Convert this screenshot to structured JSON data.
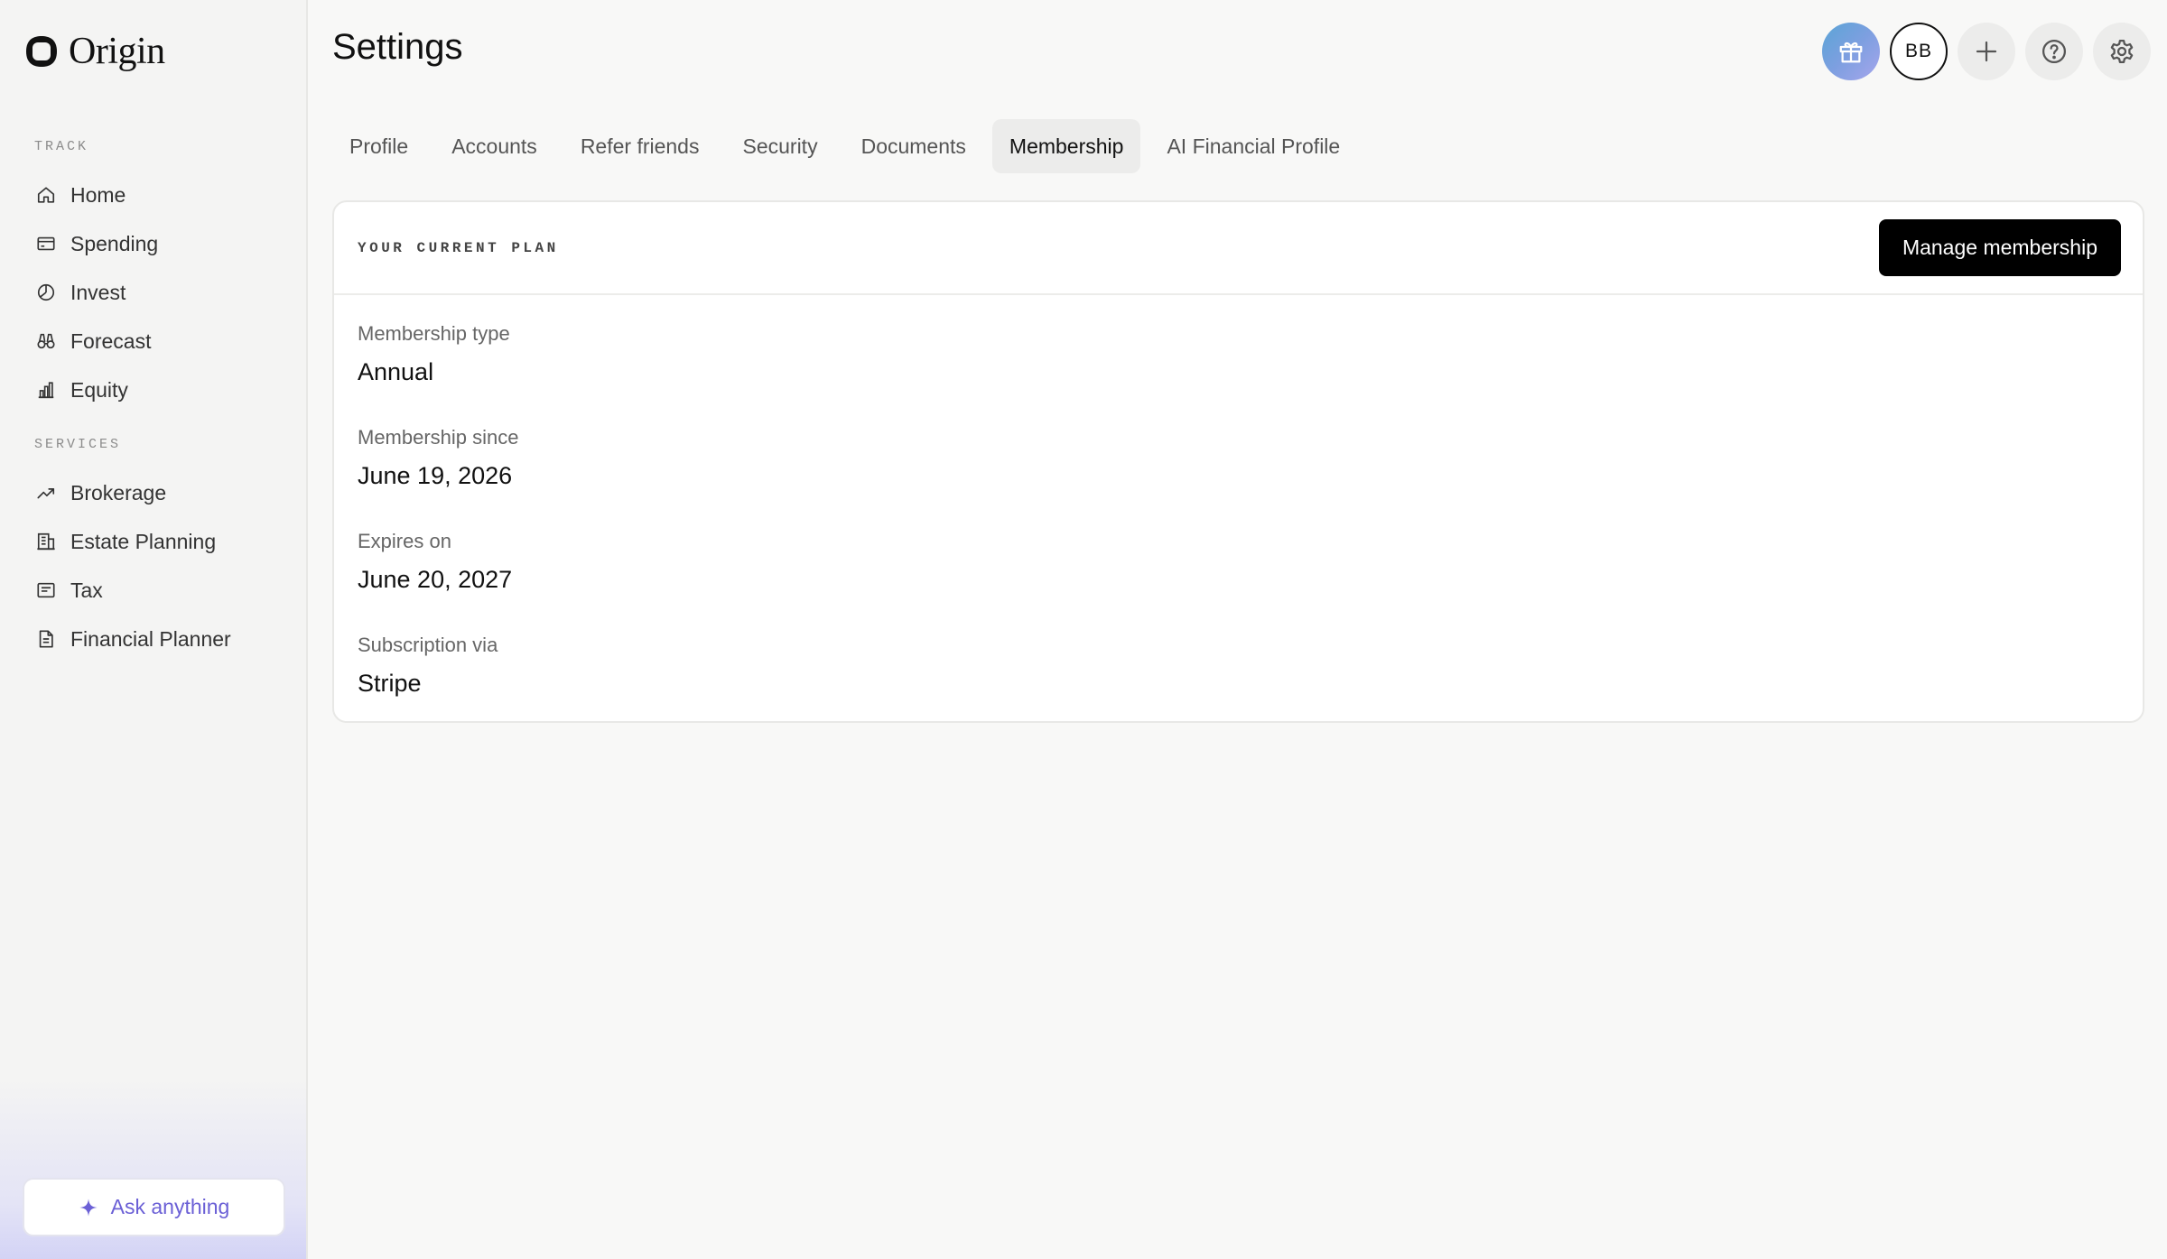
{
  "brand": {
    "name": "Origin"
  },
  "sidebar": {
    "sections": [
      {
        "label": "TRACK",
        "items": [
          {
            "label": "Home",
            "icon": "home-icon"
          },
          {
            "label": "Spending",
            "icon": "credit-card-icon"
          },
          {
            "label": "Invest",
            "icon": "pie-chart-icon"
          },
          {
            "label": "Forecast",
            "icon": "binoculars-icon"
          },
          {
            "label": "Equity",
            "icon": "bar-chart-icon"
          }
        ]
      },
      {
        "label": "SERVICES",
        "items": [
          {
            "label": "Brokerage",
            "icon": "trending-up-icon"
          },
          {
            "label": "Estate Planning",
            "icon": "building-icon"
          },
          {
            "label": "Tax",
            "icon": "receipt-icon"
          },
          {
            "label": "Financial Planner",
            "icon": "document-icon"
          }
        ]
      }
    ],
    "ask": {
      "label": "Ask anything",
      "icon": "sparkle-icon"
    }
  },
  "header": {
    "title": "Settings",
    "avatar_initials": "BB",
    "actions": [
      "gift-icon",
      "plus-icon",
      "help-icon",
      "gear-icon"
    ]
  },
  "tabs": [
    {
      "label": "Profile",
      "active": false
    },
    {
      "label": "Accounts",
      "active": false
    },
    {
      "label": "Refer friends",
      "active": false
    },
    {
      "label": "Security",
      "active": false
    },
    {
      "label": "Documents",
      "active": false
    },
    {
      "label": "Membership",
      "active": true
    },
    {
      "label": "AI Financial Profile",
      "active": false
    }
  ],
  "membership": {
    "section_label": "YOUR CURRENT PLAN",
    "manage_label": "Manage membership",
    "fields": [
      {
        "label": "Membership type",
        "value": "Annual"
      },
      {
        "label": "Membership since",
        "value": "June 19, 2026"
      },
      {
        "label": "Expires on",
        "value": "June 20, 2027"
      },
      {
        "label": "Subscription via",
        "value": "Stripe"
      }
    ]
  },
  "colors": {
    "accent": "#6b60d6",
    "primary_button": "#000000",
    "background": "#f8f8f7",
    "sidebar": "#f4f4f3"
  }
}
